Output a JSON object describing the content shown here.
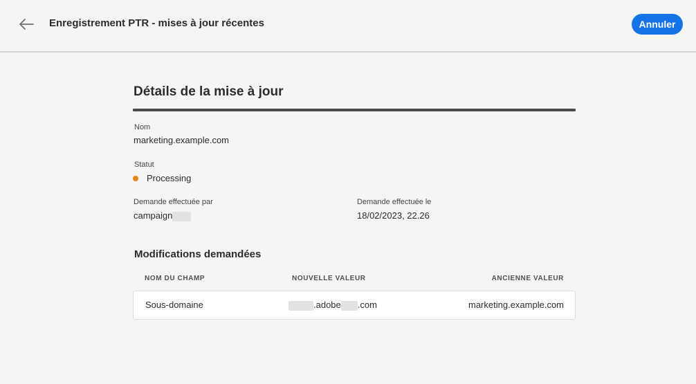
{
  "header": {
    "title": "Enregistrement PTR - mises à jour récentes",
    "cancel_label": "Annuler"
  },
  "details": {
    "section_title": "Détails de la mise à jour",
    "name_label": "Nom",
    "name_value": "marketing.example.com",
    "status_label": "Statut",
    "status_value": "Processing",
    "status_color": "#e68619",
    "requested_by_label": "Demande effectuée par",
    "requested_by_value": "campaign",
    "requested_on_label": "Demande effectuée le",
    "requested_on_value": "18/02/2023, 22.26"
  },
  "changes": {
    "title": "Modifications demandées",
    "columns": [
      "NOM DU CHAMP",
      "NOUVELLE VALEUR",
      "ANCIENNE VALEUR"
    ],
    "rows": [
      {
        "field": "Sous-domaine",
        "new_value_middle": ".adobe",
        "new_value_suffix": ".com",
        "old_value": "marketing.example.com"
      }
    ]
  },
  "colors": {
    "accent": "#1473e6",
    "background": "#f5f5f5",
    "divider": "#4b4b4b"
  },
  "icons": {
    "back": "arrow-left-icon"
  }
}
